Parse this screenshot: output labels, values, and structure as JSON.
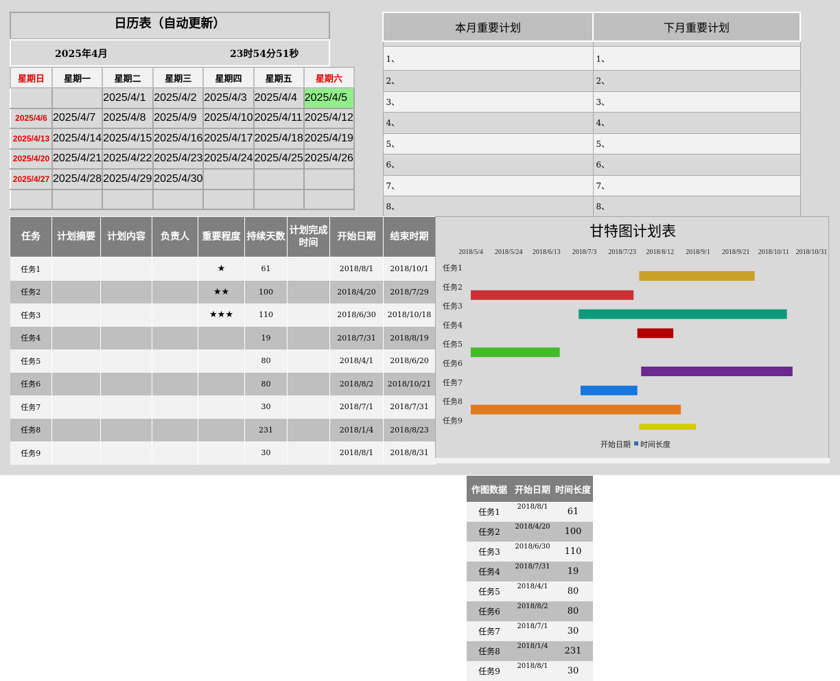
{
  "calendar": {
    "title": "日历表（自动更新）",
    "month": "2025年4月",
    "time": "23时54分51秒",
    "weekdays": [
      "星期日",
      "星期一",
      "星期二",
      "星期三",
      "星期四",
      "星期五",
      "星期六"
    ],
    "weeks": [
      [
        "",
        "",
        "2025/4/1",
        "2025/4/2",
        "2025/4/3",
        "2025/4/4",
        "2025/4/5"
      ],
      [
        "2025/4/6",
        "2025/4/7",
        "2025/4/8",
        "2025/4/9",
        "2025/4/10",
        "2025/4/11",
        "2025/4/12"
      ],
      [
        "2025/4/13",
        "2025/4/14",
        "2025/4/15",
        "2025/4/16",
        "2025/4/17",
        "2025/4/18",
        "2025/4/19"
      ],
      [
        "2025/4/20",
        "2025/4/21",
        "2025/4/22",
        "2025/4/23",
        "2025/4/24",
        "2025/4/25",
        "2025/4/26"
      ],
      [
        "2025/4/27",
        "2025/4/28",
        "2025/4/29",
        "2025/4/30",
        "",
        "",
        ""
      ],
      [
        "",
        "",
        "",
        "",
        "",
        "",
        ""
      ]
    ],
    "today_color": "#92ee8b",
    "weekend_color": "#e00000"
  },
  "plans": {
    "this_month_header": "本月重要计划",
    "next_month_header": "下月重要计划",
    "this_month": [
      "1、",
      "2、",
      "3、",
      "4、",
      "5、",
      "6、",
      "7、",
      "8、"
    ],
    "next_month": [
      "1、",
      "2、",
      "3、",
      "4、",
      "5、",
      "6、",
      "7、",
      "8、"
    ]
  },
  "tasks": {
    "headers": [
      "任务",
      "计划摘要",
      "计划内容",
      "负责人",
      "重要程度",
      "持续天数",
      "计划完成时间",
      "开始日期",
      "结束时期"
    ],
    "rows": [
      {
        "name": "任务1",
        "summary": "",
        "content": "",
        "owner": "",
        "importance": "★",
        "days": "61",
        "done": "",
        "start": "2018/8/1",
        "end": "2018/10/1"
      },
      {
        "name": "任务2",
        "summary": "",
        "content": "",
        "owner": "",
        "importance": "★★",
        "days": "100",
        "done": "",
        "start": "2018/4/20",
        "end": "2018/7/29"
      },
      {
        "name": "任务3",
        "summary": "",
        "content": "",
        "owner": "",
        "importance": "★★★",
        "days": "110",
        "done": "",
        "start": "2018/6/30",
        "end": "2018/10/18"
      },
      {
        "name": "任务4",
        "summary": "",
        "content": "",
        "owner": "",
        "importance": "",
        "days": "19",
        "done": "",
        "start": "2018/7/31",
        "end": "2018/8/19"
      },
      {
        "name": "任务5",
        "summary": "",
        "content": "",
        "owner": "",
        "importance": "",
        "days": "80",
        "done": "",
        "start": "2018/4/1",
        "end": "2018/6/20"
      },
      {
        "name": "任务6",
        "summary": "",
        "content": "",
        "owner": "",
        "importance": "",
        "days": "80",
        "done": "",
        "start": "2018/8/2",
        "end": "2018/10/21"
      },
      {
        "name": "任务7",
        "summary": "",
        "content": "",
        "owner": "",
        "importance": "",
        "days": "30",
        "done": "",
        "start": "2018/7/1",
        "end": "2018/7/31"
      },
      {
        "name": "任务8",
        "summary": "",
        "content": "",
        "owner": "",
        "importance": "",
        "days": "231",
        "done": "",
        "start": "2018/1/4",
        "end": "2018/8/23"
      },
      {
        "name": "任务9",
        "summary": "",
        "content": "",
        "owner": "",
        "importance": "",
        "days": "30",
        "done": "",
        "start": "2018/8/1",
        "end": "2018/8/31"
      }
    ]
  },
  "chart_data": {
    "type": "bar",
    "orientation": "horizontal-stacked",
    "title": "甘特图计划表",
    "categories": [
      "任务1",
      "任务2",
      "任务3",
      "任务4",
      "任务5",
      "任务6",
      "任务7",
      "任务8",
      "任务9"
    ],
    "x_tick_labels": [
      "2018/5/4",
      "2018/5/24",
      "2018/6/13",
      "2018/7/3",
      "2018/7/23",
      "2018/8/12",
      "2018/9/1",
      "2018/9/21",
      "2018/10/11",
      "2018/10/31"
    ],
    "xlim": [
      "2018/5/4",
      "2018/11/6"
    ],
    "x_axis_position": "top",
    "series": [
      {
        "name": "开始日期",
        "values": [
          "2018/8/1",
          "2018/4/20",
          "2018/6/30",
          "2018/7/31",
          "2018/4/1",
          "2018/8/2",
          "2018/7/1",
          "2018/1/4",
          "2018/8/1"
        ],
        "visible": false
      },
      {
        "name": "时间长度",
        "values": [
          61,
          100,
          110,
          19,
          80,
          80,
          30,
          231,
          30
        ],
        "visible": true
      }
    ],
    "bar_colors": [
      "#c9a227",
      "#c83232",
      "#0c9a7a",
      "#b00000",
      "#44bb2a",
      "#6a2a90",
      "#1577e0",
      "#e07a20",
      "#d4cc00"
    ],
    "legend_position": "bottom",
    "legend_swatch_color": "#3a6fb0",
    "grid": false
  },
  "plot_data_table": {
    "headers": [
      "作图数据",
      "开始日期",
      "时间长度"
    ],
    "rows": [
      {
        "name": "任务1",
        "start": "2018/8/1",
        "len": "61"
      },
      {
        "name": "任务2",
        "start": "2018/4/20",
        "len": "100"
      },
      {
        "name": "任务3",
        "start": "2018/6/30",
        "len": "110"
      },
      {
        "name": "任务4",
        "start": "2018/7/31",
        "len": "19"
      },
      {
        "name": "任务5",
        "start": "2018/4/1",
        "len": "80"
      },
      {
        "name": "任务6",
        "start": "2018/8/2",
        "len": "80"
      },
      {
        "name": "任务7",
        "start": "2018/7/1",
        "len": "30"
      },
      {
        "name": "任务8",
        "start": "2018/1/4",
        "len": "231"
      },
      {
        "name": "任务9",
        "start": "2018/8/1",
        "len": "30"
      }
    ]
  }
}
